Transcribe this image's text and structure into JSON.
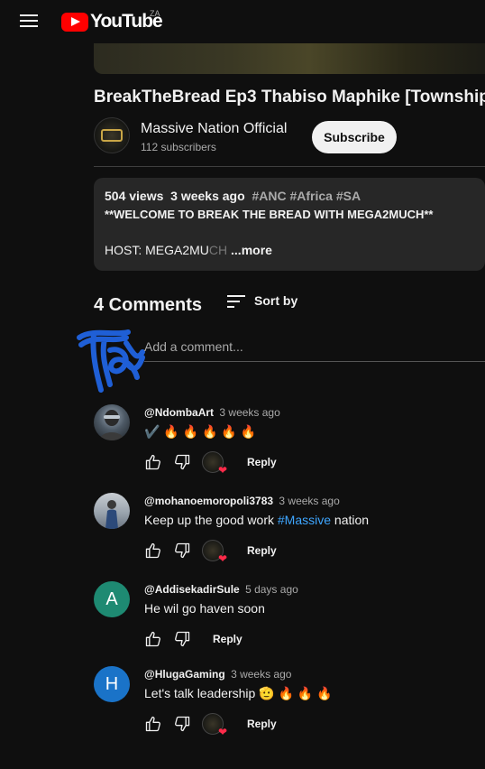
{
  "header": {
    "logo_text": "YouTube",
    "country_code": "ZA"
  },
  "video": {
    "title": "BreakTheBread Ep3 Thabiso Maphike [Township",
    "channel_name": "Massive Nation Official",
    "subscribers": "112 subscribers",
    "subscribe_label": "Subscribe"
  },
  "description": {
    "views": "504 views",
    "age": "3 weeks ago",
    "tags": [
      "#ANC",
      "#Africa",
      "#SA"
    ],
    "line1": "**WELCOME TO BREAK THE BREAD WITH MEGA2MUCH**",
    "host_prefix": "HOST: MEGA2MU",
    "host_fade": "CH",
    "more_label": "...more"
  },
  "comments_section": {
    "count_label": "4 Comments",
    "sort_label": "Sort by",
    "add_placeholder": "Add a comment...",
    "reply_label": "Reply",
    "items": [
      {
        "author": "@NdombaArt",
        "time": "3 weeks ago",
        "text": "✔️ 🔥 🔥 🔥 🔥 🔥",
        "avatar_kind": "photo",
        "avatar_color": "#6b7a8a",
        "has_creator_heart": true
      },
      {
        "author": "@mohanoemoropoli3783",
        "time": "3 weeks ago",
        "text_before": "Keep up the good work ",
        "hashtag": "#Massive",
        "text_after": " nation",
        "avatar_kind": "photo",
        "avatar_color": "#9aa6b0",
        "has_creator_heart": true
      },
      {
        "author": "@AddisekadirSule",
        "time": "5 days ago",
        "text": "He wil go haven soon",
        "avatar_letter": "A",
        "avatar_color": "#1e8a72",
        "has_creator_heart": false
      },
      {
        "author": "@HlugaGaming",
        "time": "3 weeks ago",
        "text": "Let's talk leadership 🫡 🔥 🔥 🔥",
        "avatar_letter": "H",
        "avatar_color": "#1a73c8",
        "has_creator_heart": true
      }
    ]
  },
  "colors": {
    "background": "#0f0f0f",
    "hashtag_blue": "#3ea6ff",
    "youtube_red": "#ff0000",
    "heart_red": "#ff2b4a",
    "scribble_blue": "#1f5fd6"
  }
}
